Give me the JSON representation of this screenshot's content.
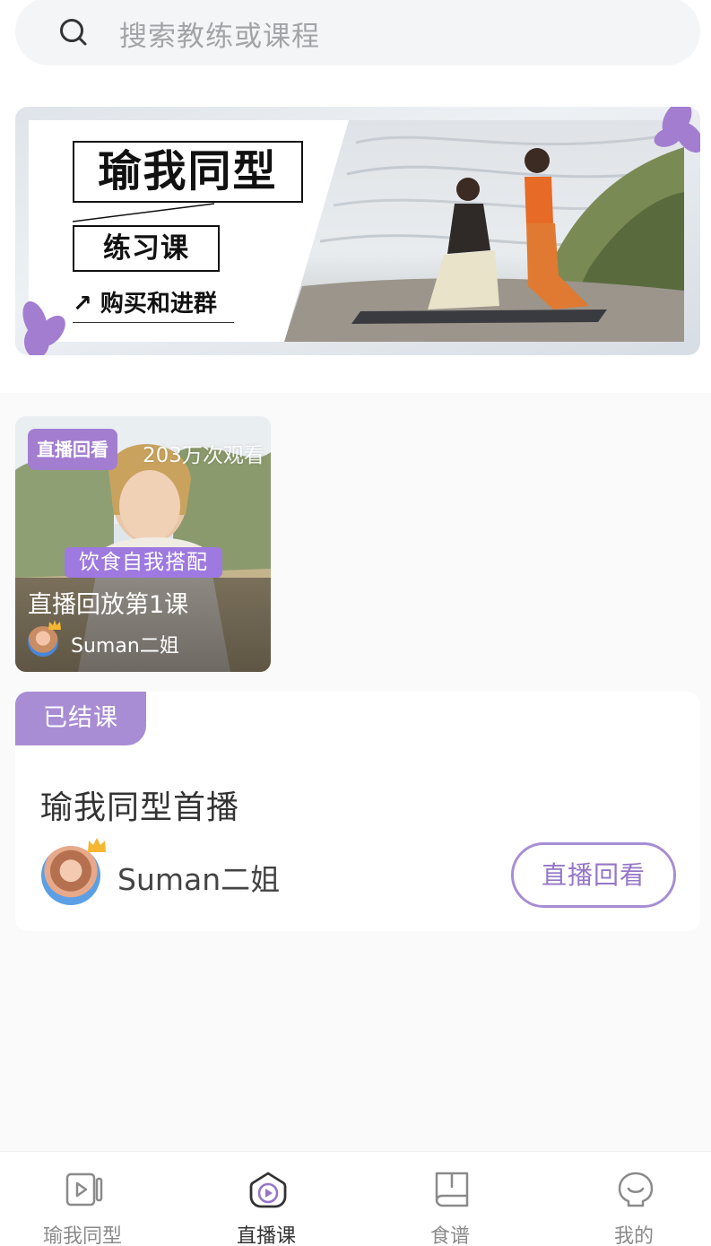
{
  "search": {
    "placeholder": "搜索教练或课程",
    "icon": "search-icon"
  },
  "banner": {
    "title": "瑜我同型",
    "subtitle": "练习课",
    "link": "↗ 购买和进群"
  },
  "video_card": {
    "badge": "直播回看",
    "views": "203万次观看",
    "tag": "饮食自我搭配",
    "title": "直播回放第1课",
    "author": "Suman二姐"
  },
  "course_card": {
    "status": "已结课",
    "title": "瑜我同型首播",
    "author": "Suman二姐",
    "button": "直播回看"
  },
  "bottom_nav": {
    "items": [
      {
        "label": "瑜我同型",
        "icon": "video-icon",
        "active": false
      },
      {
        "label": "直播课",
        "icon": "live-icon",
        "active": true
      },
      {
        "label": "食谱",
        "icon": "book-icon",
        "active": false
      },
      {
        "label": "我的",
        "icon": "profile-icon",
        "active": false
      }
    ]
  },
  "colors": {
    "accent_purple": "#a88dd4",
    "badge_purple": "#a27dd0",
    "search_bg": "#f4f5f7",
    "page_bg": "#fafafa"
  }
}
